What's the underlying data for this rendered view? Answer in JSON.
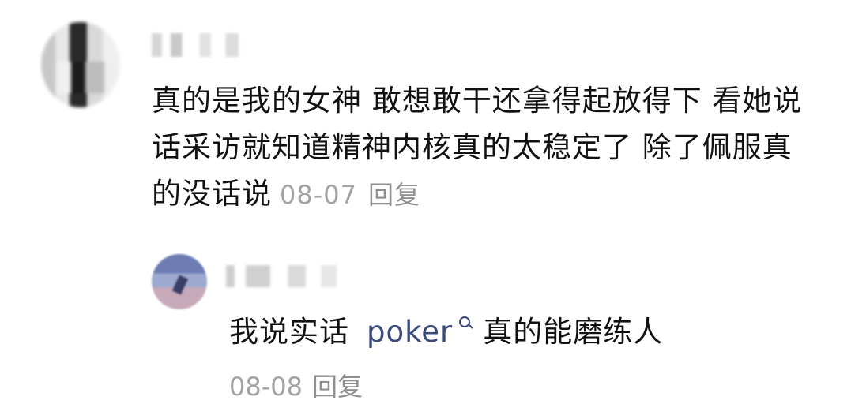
{
  "comment": {
    "text": "真的是我的女神 敢想敢干还拿得起放得下 看她说话采访就知道精神内核真的太稳定了 除了佩服真的没话说",
    "date": "08-07",
    "reply_label": "回复"
  },
  "reply": {
    "text_before": "我说实话",
    "mention": "poker",
    "mention_icon": "search-icon",
    "text_after": "真的能磨练人",
    "date": "08-08",
    "reply_label": "回复"
  }
}
